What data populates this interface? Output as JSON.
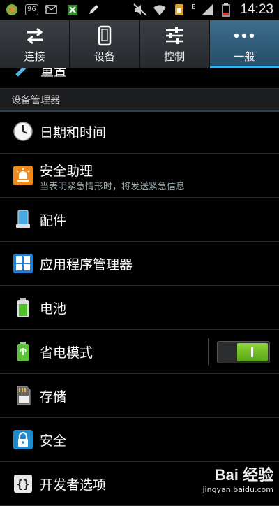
{
  "status_bar": {
    "badge": "96",
    "network": "E",
    "time": "14:23"
  },
  "tabs": [
    {
      "label": "连接",
      "icon": "swap-arrows-icon"
    },
    {
      "label": "设备",
      "icon": "phone-icon"
    },
    {
      "label": "控制",
      "icon": "sliders-icon"
    },
    {
      "label": "一般",
      "icon": "more-dots-icon",
      "active": true
    }
  ],
  "partial_item": {
    "label": "重置"
  },
  "section": {
    "title": "设备管理器"
  },
  "items": [
    {
      "label": "日期和时间",
      "icon": "clock-icon"
    },
    {
      "label": "安全助理",
      "sub": "当表明紧急情形时，将发送紧急信息",
      "icon": "alarm-icon"
    },
    {
      "label": "配件",
      "icon": "device-accessory-icon"
    },
    {
      "label": "应用程序管理器",
      "icon": "app-grid-icon"
    },
    {
      "label": "电池",
      "icon": "battery-icon"
    },
    {
      "label": "省电模式",
      "icon": "power-saving-icon",
      "toggle": true
    },
    {
      "label": "存储",
      "icon": "sd-card-icon"
    },
    {
      "label": "安全",
      "icon": "lock-icon"
    },
    {
      "label": "开发者选项",
      "icon": "braces-icon"
    }
  ],
  "watermark": {
    "line1": "Bai 经验",
    "line2": "jingyan.baidu.com"
  },
  "colors": {
    "accent": "#35b6ee",
    "toggle_on": "#6cbf1e",
    "active_tab": "#2f5d7a"
  }
}
